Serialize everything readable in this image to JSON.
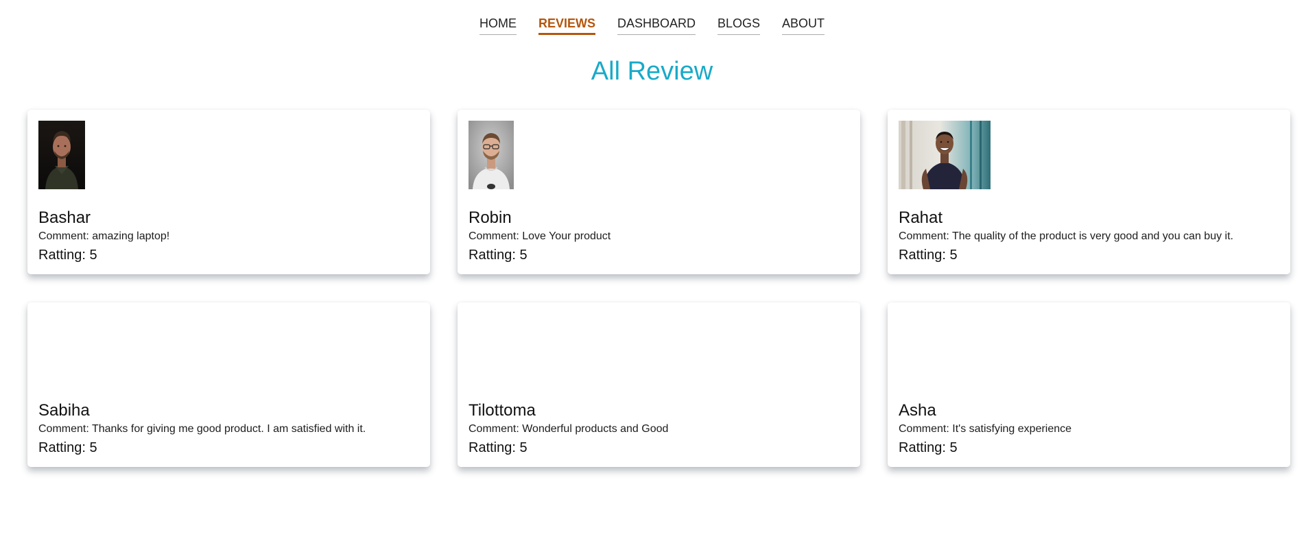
{
  "nav": {
    "items": [
      {
        "label": "HOME"
      },
      {
        "label": "REVIEWS",
        "active": true
      },
      {
        "label": "DASHBOARD"
      },
      {
        "label": "BLOGS"
      },
      {
        "label": "ABOUT"
      }
    ],
    "active_color": "#b5560c"
  },
  "page": {
    "title": "All Review",
    "title_color": "#19aac9"
  },
  "reviews": [
    {
      "name": "Bashar",
      "comment": "Comment: amazing laptop!",
      "rating": "Ratting: 5",
      "avatar": "man-portrait-dark-beard"
    },
    {
      "name": "Robin",
      "comment": "Comment: Love Your product",
      "rating": "Ratting: 5",
      "avatar": "man-portrait-glasses"
    },
    {
      "name": "Rahat",
      "comment": "Comment: The quality of the product is very good and you can buy it.",
      "rating": "Ratting: 5",
      "avatar": "man-portrait-smiling-street"
    },
    {
      "name": "Sabiha",
      "comment": "Comment: Thanks for giving me good product. I am satisfied with it.",
      "rating": "Ratting: 5",
      "avatar": ""
    },
    {
      "name": "Tilottoma",
      "comment": "Comment: Wonderful products and Good",
      "rating": "Ratting: 5",
      "avatar": ""
    },
    {
      "name": "Asha",
      "comment": "Comment: It's satisfying experience",
      "rating": "Ratting: 5",
      "avatar": ""
    }
  ]
}
